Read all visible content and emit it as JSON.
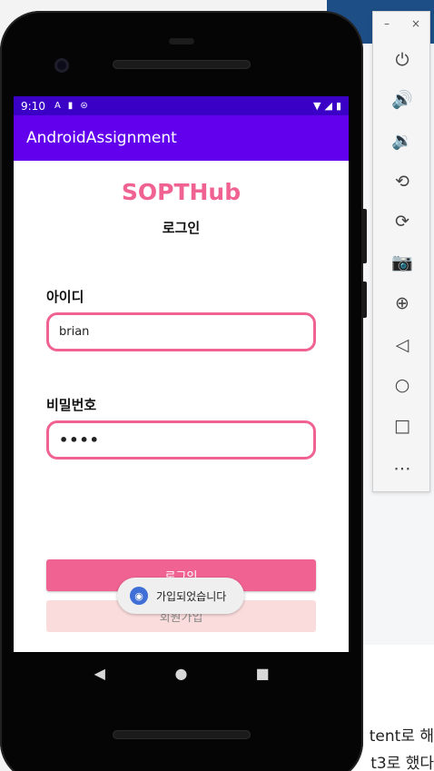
{
  "background": {
    "line1": "tent로 해",
    "line2": "t3로 했다"
  },
  "status_bar": {
    "time": "9:10",
    "icons": [
      "A",
      "sd-card",
      "usb"
    ],
    "right_icons": [
      "wifi",
      "signal",
      "battery"
    ]
  },
  "app_bar": {
    "title": "AndroidAssignment"
  },
  "content": {
    "logo_title": "SOPTHub",
    "subtitle": "로그인",
    "id_label": "아이디",
    "id_value": "brian",
    "pw_label": "비밀번호",
    "pw_value": "••••",
    "login_button": "로그인",
    "signup_button": "회원가입"
  },
  "toast": {
    "text": "가입되었습니다"
  },
  "nav": {
    "back": "back-icon",
    "home": "home-icon",
    "recents": "recents-icon"
  },
  "toolbar": {
    "minimize": "–",
    "close": "×",
    "items": [
      "power-icon",
      "volume-up-icon",
      "volume-down-icon",
      "rotate-left-icon",
      "rotate-right-icon",
      "camera-icon",
      "zoom-icon",
      "back-icon",
      "home-icon",
      "overview-icon",
      "more-icon"
    ]
  },
  "colors": {
    "accent": "#f06292",
    "status_bar": "#3a00c5",
    "app_bar": "#6200ee"
  }
}
